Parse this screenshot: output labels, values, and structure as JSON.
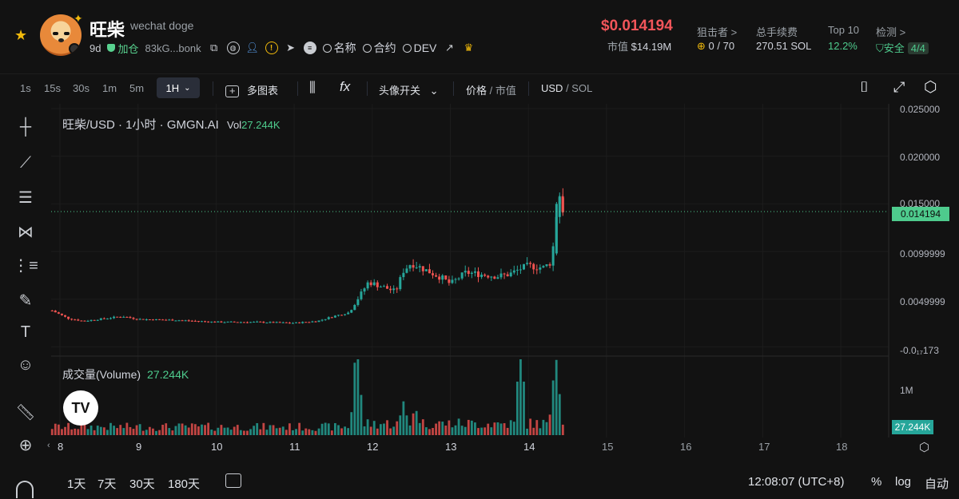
{
  "token": {
    "name": "旺柴",
    "full_name": "wechat doge",
    "age": "9d",
    "position_label": "加仓",
    "address_short": "83kG...bonk",
    "links": [
      "名称",
      "合约",
      "DEV"
    ]
  },
  "market": {
    "price": "$0.014194",
    "mcap_label": "市值",
    "mcap_value": "$14.19M"
  },
  "stats": [
    {
      "label": "狙击者 >",
      "value": "0 / 70"
    },
    {
      "label": "总手续费",
      "value": "270.51 SOL"
    },
    {
      "label": "Top 10",
      "value": "12.2%"
    },
    {
      "label": "检测 >",
      "value": "安全",
      "badge": "4/4"
    }
  ],
  "toolbar": {
    "intervals": [
      "1s",
      "15s",
      "30s",
      "1m",
      "5m"
    ],
    "selected_interval": "1H",
    "multi_chart": "多图表",
    "fx": "fx",
    "avatar_toggle": "头像开关",
    "price_label": "价格",
    "mcap_label": "市值",
    "usd": "USD",
    "sol": "SOL"
  },
  "chart": {
    "legend_title": "旺柴/USD · 1小时 · GMGN.AI",
    "vol_label": "Vol",
    "vol_value": "27.244K",
    "volume_label": "成交量(Volume)",
    "volume_value": "27.244K",
    "current_price_tag": "0.014194",
    "volume_tag": "27.244K",
    "volume_axis_label": "1M",
    "y_ticks": [
      "0.025000",
      "0.020000",
      "0.015000",
      "0.0099999",
      "0.0049999",
      "-0.0₁₇173"
    ],
    "x_ticks": [
      "8",
      "9",
      "10",
      "11",
      "12",
      "13",
      "14",
      "15",
      "16",
      "17",
      "18"
    ],
    "logo": "TV"
  },
  "chart_data": {
    "type": "candlestick",
    "price_ylim": [
      -0.0003,
      0.025
    ],
    "x_range_days": [
      8,
      18.5
    ],
    "current_price": 0.014194,
    "price_path": [
      [
        7.9,
        0.0038
      ],
      [
        8.1,
        0.003
      ],
      [
        8.3,
        0.0027
      ],
      [
        8.6,
        0.003
      ],
      [
        8.8,
        0.0032
      ],
      [
        9.0,
        0.0029
      ],
      [
        9.5,
        0.0028
      ],
      [
        10.0,
        0.0026
      ],
      [
        10.5,
        0.0026
      ],
      [
        11.0,
        0.0025
      ],
      [
        11.3,
        0.0027
      ],
      [
        11.5,
        0.0032
      ],
      [
        11.7,
        0.0036
      ],
      [
        11.85,
        0.0055
      ],
      [
        11.95,
        0.0068
      ],
      [
        12.1,
        0.0064
      ],
      [
        12.3,
        0.0058
      ],
      [
        12.4,
        0.008
      ],
      [
        12.5,
        0.0088
      ],
      [
        12.65,
        0.0082
      ],
      [
        12.8,
        0.0076
      ],
      [
        12.9,
        0.0072
      ],
      [
        13.0,
        0.0066
      ],
      [
        13.2,
        0.0078
      ],
      [
        13.4,
        0.0076
      ],
      [
        13.6,
        0.0074
      ],
      [
        13.75,
        0.0076
      ],
      [
        13.9,
        0.0082
      ],
      [
        14.0,
        0.0085
      ],
      [
        14.2,
        0.0083
      ],
      [
        14.3,
        0.009
      ],
      [
        14.35,
        0.0135
      ],
      [
        14.4,
        0.0158
      ],
      [
        14.45,
        0.0142
      ]
    ],
    "volume_peaks": [
      {
        "x": 11.8,
        "v": 1.0
      },
      {
        "x": 12.4,
        "v": 0.35
      },
      {
        "x": 12.55,
        "v": 0.3
      },
      {
        "x": 13.9,
        "v": 0.95
      },
      {
        "x": 14.35,
        "v": 0.85
      }
    ],
    "volume_ylim": [
      0,
      1.1
    ],
    "volume_unit": "M",
    "up_color": "#26a69a",
    "down_color": "#ef5350"
  },
  "bottom": {
    "ranges": [
      "1天",
      "7天",
      "30天",
      "180天"
    ],
    "clock": "12:08:07 (UTC+8)",
    "percent": "%",
    "log": "log",
    "auto": "自动"
  },
  "colors": {
    "accent_red": "#f2555a",
    "accent_green": "#4ecb8d",
    "background": "#121212"
  }
}
